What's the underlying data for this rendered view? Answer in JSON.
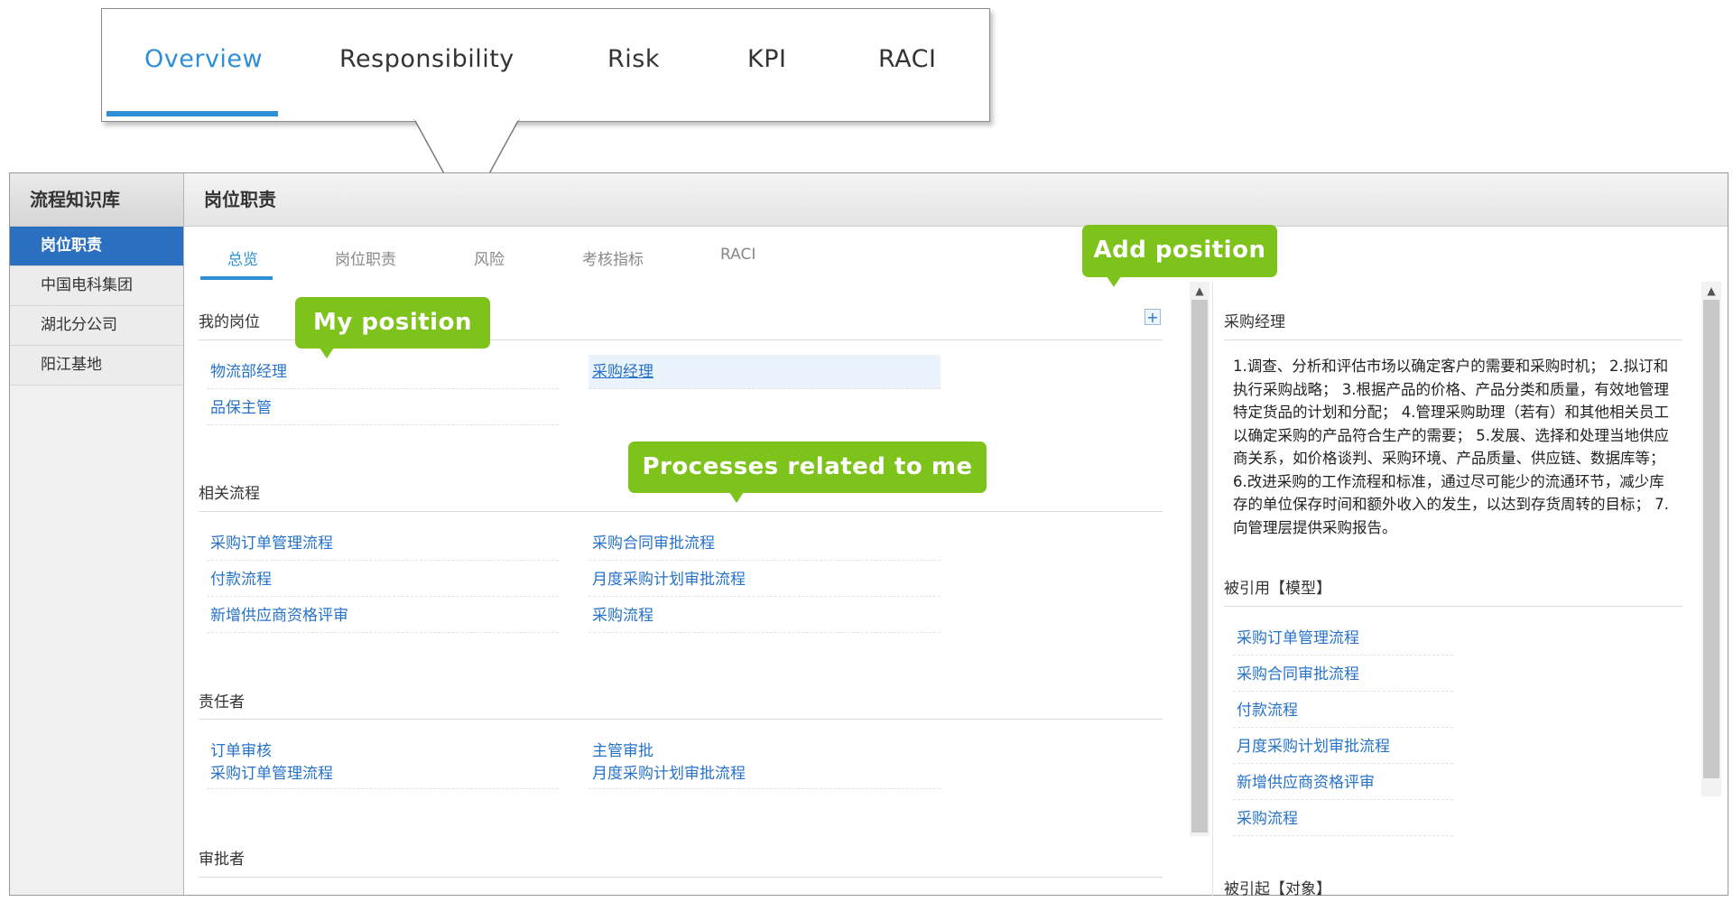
{
  "callout": {
    "tabs": [
      {
        "label": "Overview",
        "active": true
      },
      {
        "label": "Responsibility",
        "active": false
      },
      {
        "label": "Risk",
        "active": false
      },
      {
        "label": "KPI",
        "active": false
      },
      {
        "label": "RACI",
        "active": false
      }
    ]
  },
  "sidebar": {
    "title": "流程知识库",
    "items": [
      {
        "label": "岗位职责",
        "active": true
      },
      {
        "label": "中国电科集团",
        "active": false
      },
      {
        "label": "湖北分公司",
        "active": false
      },
      {
        "label": "阳江基地",
        "active": false
      }
    ]
  },
  "header": {
    "title": "岗位职责"
  },
  "subtabs": [
    {
      "label": "总览",
      "active": true
    },
    {
      "label": "岗位职责",
      "active": false
    },
    {
      "label": "风险",
      "active": false
    },
    {
      "label": "考核指标",
      "active": false
    },
    {
      "label": "RACI",
      "active": false
    }
  ],
  "main": {
    "my_position": {
      "title": "我的岗位",
      "items": [
        "物流部经理",
        "采购经理",
        "品保主管"
      ],
      "selected": "采购经理"
    },
    "related_processes": {
      "title": "相关流程",
      "items": [
        "采购订单管理流程",
        "采购合同审批流程",
        "付款流程",
        "月度采购计划审批流程",
        "新增供应商资格评审",
        "采购流程"
      ]
    },
    "responsible": {
      "title": "责任者",
      "items": [
        {
          "line1": "订单审核",
          "line2": "采购订单管理流程"
        },
        {
          "line1": "主管审批",
          "line2": "月度采购计划审批流程"
        }
      ]
    },
    "approver": {
      "title": "审批者"
    },
    "add_icon": "plus-icon"
  },
  "right_panel": {
    "title": "采购经理",
    "description": "1.调查、分析和评估市场以确定客户的需要和采购时机； 2.拟订和执行采购战略； 3.根据产品的价格、产品分类和质量，有效地管理特定货品的计划和分配； 4.管理采购助理（若有）和其他相关员工以确定采购的产品符合生产的需要； 5.发展、选择和处理当地供应商关系，如价格谈判、采购环境、产品质量、供应链、数据库等； 6.改进采购的工作流程和标准，通过尽可能少的流通环节，减少库存的单位保存时间和额外收入的发生，以达到存货周转的目标； 7.向管理层提供采购报告。",
    "referenced_model": {
      "title": "被引用【模型】",
      "items": [
        "采购订单管理流程",
        "采购合同审批流程",
        "付款流程",
        "月度采购计划审批流程",
        "新增供应商资格评审",
        "采购流程"
      ]
    },
    "referenced_object": {
      "title": "被引起【对象】"
    }
  },
  "annotations": {
    "add_position": "Add position",
    "my_position": "My position",
    "processes_related": "Processes related to me"
  },
  "colors": {
    "accent": "#2f8fd6",
    "link": "#2672c8",
    "badge": "#7dc31c",
    "sidebar_active": "#2a6fc0"
  }
}
